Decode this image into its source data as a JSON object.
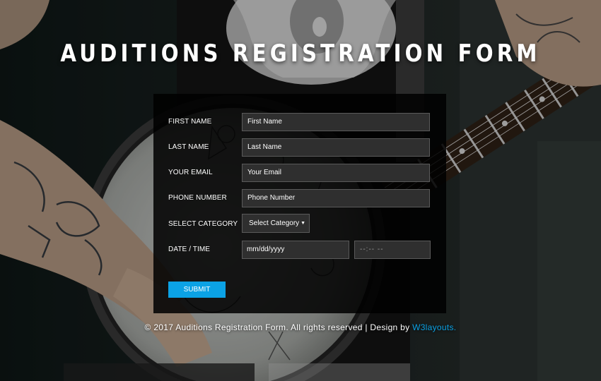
{
  "title": "Auditions Registration Form",
  "form": {
    "first_name": {
      "label": "FIRST NAME",
      "placeholder": "First Name"
    },
    "last_name": {
      "label": "LAST NAME",
      "placeholder": "Last Name"
    },
    "email": {
      "label": "YOUR EMAIL",
      "placeholder": "Your Email"
    },
    "phone": {
      "label": "PHONE NUMBER",
      "placeholder": "Phone Number"
    },
    "category": {
      "label": "SELECT CATEGORY",
      "selected": "Select Category",
      "chevron_icon": "triangle-down-icon"
    },
    "datetime": {
      "label": "DATE / TIME",
      "date_placeholder": "mm/dd/yyyy",
      "time_placeholder": "--:-- --"
    },
    "submit_label": "SUBMIT"
  },
  "footer": {
    "text": "© 2017 Auditions Registration Form. All rights reserved | Design by",
    "link_text": "W3layouts."
  },
  "colors": {
    "accent": "#0ba2e5",
    "panel_bg": "#000000",
    "input_bg": "#2f2f2f",
    "text": "#ffffff"
  }
}
